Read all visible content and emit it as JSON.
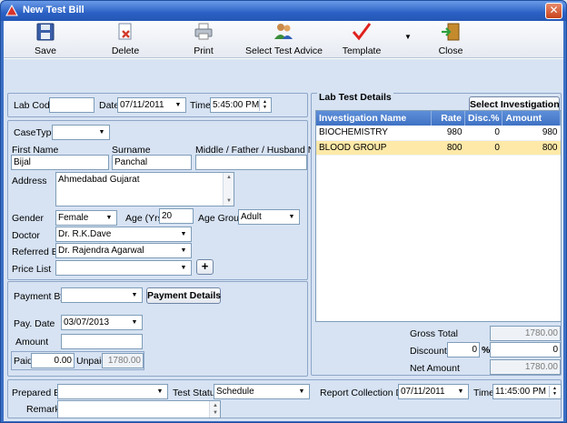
{
  "window": {
    "title": "New Test Bill"
  },
  "toolbar": {
    "save": "Save",
    "delete": "Delete",
    "print": "Print",
    "select_test_advice": "Select Test Advice",
    "template": "Template",
    "close": "Close"
  },
  "lab": {
    "lab_code_label": "Lab Code",
    "lab_code_value": "",
    "date_label": "Date",
    "date_value": "07/11/2011",
    "time_label": "Time",
    "time_value": "5:45:00 PM"
  },
  "patient": {
    "casetype_label": "CaseType",
    "casetype_value": "",
    "first_name_label": "First Name",
    "first_name_value": "Bijal",
    "surname_label": "Surname",
    "surname_value": "Panchal",
    "middle_label": "Middle / Father / Husband Name",
    "middle_value": "",
    "address_label": "Address",
    "address_value": "Ahmedabad Gujarat",
    "gender_label": "Gender",
    "gender_value": "Female",
    "age_label": "Age (Yrs)",
    "age_value": "20",
    "age_group_label": "Age Group",
    "age_group_value": "Adult",
    "doctor_label": "Doctor",
    "doctor_value": "Dr. R.K.Dave",
    "referred_label": "Referred By",
    "referred_value": "Dr. Rajendra Agarwal",
    "price_list_label": "Price List",
    "price_list_value": "",
    "add_symbol": "+"
  },
  "payment": {
    "payment_by_label": "Payment By",
    "payment_by_value": "",
    "details_button": "Payment Details",
    "pay_date_label": "Pay. Date",
    "pay_date_value": "03/07/2013",
    "amount_label": "Amount",
    "amount_value": "",
    "paid_label": "Paid",
    "paid_value": "0.00",
    "unpaid_label": "Unpaid",
    "unpaid_value": "1780.00"
  },
  "tests": {
    "group_label": "Lab Test Details",
    "select_button": "Select Investigation",
    "columns": [
      "Investigation Name",
      "Rate",
      "Disc.%",
      "Amount"
    ],
    "rows": [
      {
        "name": "BIOCHEMISTRY",
        "rate": "980",
        "disc": "0",
        "amount": "980"
      },
      {
        "name": "BLOOD GROUP",
        "rate": "800",
        "disc": "0",
        "amount": "800"
      }
    ]
  },
  "totals": {
    "gross_label": "Gross Total",
    "gross_value": "1780.00",
    "discount_label": "Discount",
    "discount_pct": "0",
    "pct_symbol": "%",
    "discount_value": "0",
    "net_label": "Net Amount",
    "net_value": "1780.00"
  },
  "footer": {
    "prepared_label": "Prepared By",
    "prepared_value": "",
    "status_label": "Test Status",
    "status_value": "Schedule",
    "report_date_label": "Report Collection Date",
    "report_date_value": "07/11/2011",
    "time_label": "Time",
    "time_value": "11:45:00 PM",
    "remark_label": "Remark",
    "remark_value": ""
  }
}
